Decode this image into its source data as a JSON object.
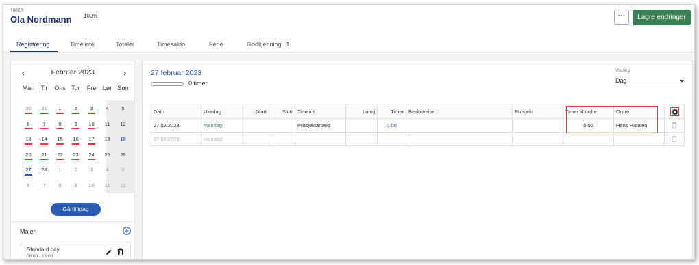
{
  "header": {
    "caption": "TIMER",
    "user_name": "Ola Nordmann",
    "percent": "100%",
    "more_label": "···",
    "save_label": "Lagre endringer"
  },
  "tabs": [
    {
      "label": "Registrering",
      "active": true
    },
    {
      "label": "Timeliste"
    },
    {
      "label": "Totaler"
    },
    {
      "label": "Timesaldo"
    },
    {
      "label": "Ferie"
    },
    {
      "label": "Godkjenning",
      "badge": "1"
    }
  ],
  "calendar": {
    "prev": "‹",
    "next": "›",
    "title": "Februar 2023",
    "weekdays": [
      "Man",
      "Tir",
      "Ons",
      "Tor",
      "Fre",
      "Lør",
      "Søn"
    ],
    "weeks": [
      [
        {
          "d": "30",
          "m": true,
          "u": true
        },
        {
          "d": "31",
          "m": true,
          "u": true
        },
        {
          "d": "1",
          "u": true
        },
        {
          "d": "2",
          "u": true
        },
        {
          "d": "3",
          "u": true
        },
        {
          "d": "4"
        },
        {
          "d": "5"
        }
      ],
      [
        {
          "d": "6",
          "u": true
        },
        {
          "d": "7",
          "u": true
        },
        {
          "d": "8",
          "u": true
        },
        {
          "d": "9",
          "u": true
        },
        {
          "d": "10",
          "u": true
        },
        {
          "d": "11"
        },
        {
          "d": "12"
        }
      ],
      [
        {
          "d": "13",
          "u": true
        },
        {
          "d": "14",
          "u": true
        },
        {
          "d": "15",
          "u": true
        },
        {
          "d": "16",
          "u": true
        },
        {
          "d": "17",
          "u": true
        },
        {
          "d": "18"
        },
        {
          "d": "19",
          "today": true
        }
      ],
      [
        {
          "d": "20",
          "u": true
        },
        {
          "d": "21",
          "u": true
        },
        {
          "d": "22",
          "u": true
        },
        {
          "d": "23",
          "u": true
        },
        {
          "d": "24",
          "u": true
        },
        {
          "d": "25"
        },
        {
          "d": "26"
        }
      ],
      [
        {
          "d": "27",
          "sel": true,
          "u": true
        },
        {
          "d": "28"
        },
        {
          "d": "1",
          "m": true
        },
        {
          "d": "2",
          "m": true
        },
        {
          "d": "3",
          "m": true
        },
        {
          "d": "4",
          "m": true
        },
        {
          "d": "5",
          "m": true
        }
      ],
      [
        {
          "d": "6",
          "m": true
        },
        {
          "d": "7",
          "m": true
        },
        {
          "d": "8",
          "m": true
        },
        {
          "d": "9",
          "m": true
        },
        {
          "d": "10",
          "m": true
        },
        {
          "d": "11",
          "m": true
        },
        {
          "d": "12",
          "m": true
        }
      ]
    ],
    "goto_today": "Gå til idag"
  },
  "templates": {
    "label": "Maler",
    "items": [
      {
        "title": "Standard day",
        "time": "08:00 - 16:00"
      }
    ]
  },
  "day": {
    "date_title": "27 februar 2023",
    "progress": 0,
    "hours_label": "0 timer",
    "view_label": "Visning",
    "view_value": "Dag"
  },
  "table": {
    "columns": [
      "Dato",
      "Ukedag",
      "Start",
      "Slutt",
      "Timeart",
      "Lunsj",
      "Timer",
      "Beskrivelse",
      "Prosjekt",
      "Timer til ordre",
      "Ordre"
    ],
    "rows": [
      [
        "27.02.2023",
        "mandag",
        "",
        "",
        "Prosjektarbeid",
        "",
        "0.00",
        "",
        "",
        "5.00",
        "Hans Hansen"
      ],
      [
        "27.02.2023",
        "mandag",
        "",
        "",
        "",
        "",
        "",
        "",
        "",
        "",
        ""
      ]
    ]
  },
  "colors": {
    "accent": "#2a5db0",
    "brand_dark": "#1a2e6e",
    "save_green": "#3b8054",
    "highlight_red": "#e0383d"
  }
}
